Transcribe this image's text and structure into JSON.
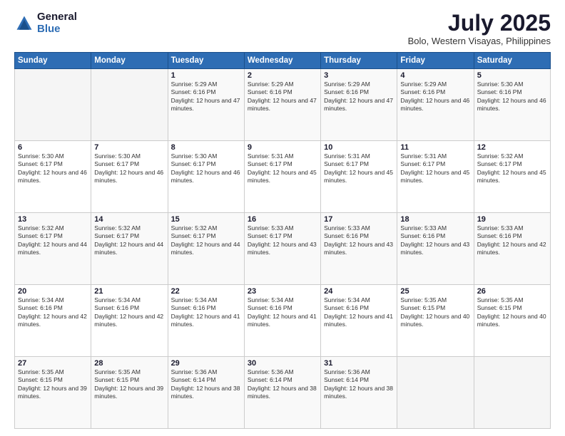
{
  "logo": {
    "general": "General",
    "blue": "Blue"
  },
  "header": {
    "month_year": "July 2025",
    "location": "Bolo, Western Visayas, Philippines"
  },
  "weekdays": [
    "Sunday",
    "Monday",
    "Tuesday",
    "Wednesday",
    "Thursday",
    "Friday",
    "Saturday"
  ],
  "weeks": [
    [
      {
        "day": "",
        "sunrise": "",
        "sunset": "",
        "daylight": ""
      },
      {
        "day": "",
        "sunrise": "",
        "sunset": "",
        "daylight": ""
      },
      {
        "day": "1",
        "sunrise": "Sunrise: 5:29 AM",
        "sunset": "Sunset: 6:16 PM",
        "daylight": "Daylight: 12 hours and 47 minutes."
      },
      {
        "day": "2",
        "sunrise": "Sunrise: 5:29 AM",
        "sunset": "Sunset: 6:16 PM",
        "daylight": "Daylight: 12 hours and 47 minutes."
      },
      {
        "day": "3",
        "sunrise": "Sunrise: 5:29 AM",
        "sunset": "Sunset: 6:16 PM",
        "daylight": "Daylight: 12 hours and 47 minutes."
      },
      {
        "day": "4",
        "sunrise": "Sunrise: 5:29 AM",
        "sunset": "Sunset: 6:16 PM",
        "daylight": "Daylight: 12 hours and 46 minutes."
      },
      {
        "day": "5",
        "sunrise": "Sunrise: 5:30 AM",
        "sunset": "Sunset: 6:16 PM",
        "daylight": "Daylight: 12 hours and 46 minutes."
      }
    ],
    [
      {
        "day": "6",
        "sunrise": "Sunrise: 5:30 AM",
        "sunset": "Sunset: 6:17 PM",
        "daylight": "Daylight: 12 hours and 46 minutes."
      },
      {
        "day": "7",
        "sunrise": "Sunrise: 5:30 AM",
        "sunset": "Sunset: 6:17 PM",
        "daylight": "Daylight: 12 hours and 46 minutes."
      },
      {
        "day": "8",
        "sunrise": "Sunrise: 5:30 AM",
        "sunset": "Sunset: 6:17 PM",
        "daylight": "Daylight: 12 hours and 46 minutes."
      },
      {
        "day": "9",
        "sunrise": "Sunrise: 5:31 AM",
        "sunset": "Sunset: 6:17 PM",
        "daylight": "Daylight: 12 hours and 45 minutes."
      },
      {
        "day": "10",
        "sunrise": "Sunrise: 5:31 AM",
        "sunset": "Sunset: 6:17 PM",
        "daylight": "Daylight: 12 hours and 45 minutes."
      },
      {
        "day": "11",
        "sunrise": "Sunrise: 5:31 AM",
        "sunset": "Sunset: 6:17 PM",
        "daylight": "Daylight: 12 hours and 45 minutes."
      },
      {
        "day": "12",
        "sunrise": "Sunrise: 5:32 AM",
        "sunset": "Sunset: 6:17 PM",
        "daylight": "Daylight: 12 hours and 45 minutes."
      }
    ],
    [
      {
        "day": "13",
        "sunrise": "Sunrise: 5:32 AM",
        "sunset": "Sunset: 6:17 PM",
        "daylight": "Daylight: 12 hours and 44 minutes."
      },
      {
        "day": "14",
        "sunrise": "Sunrise: 5:32 AM",
        "sunset": "Sunset: 6:17 PM",
        "daylight": "Daylight: 12 hours and 44 minutes."
      },
      {
        "day": "15",
        "sunrise": "Sunrise: 5:32 AM",
        "sunset": "Sunset: 6:17 PM",
        "daylight": "Daylight: 12 hours and 44 minutes."
      },
      {
        "day": "16",
        "sunrise": "Sunrise: 5:33 AM",
        "sunset": "Sunset: 6:17 PM",
        "daylight": "Daylight: 12 hours and 43 minutes."
      },
      {
        "day": "17",
        "sunrise": "Sunrise: 5:33 AM",
        "sunset": "Sunset: 6:16 PM",
        "daylight": "Daylight: 12 hours and 43 minutes."
      },
      {
        "day": "18",
        "sunrise": "Sunrise: 5:33 AM",
        "sunset": "Sunset: 6:16 PM",
        "daylight": "Daylight: 12 hours and 43 minutes."
      },
      {
        "day": "19",
        "sunrise": "Sunrise: 5:33 AM",
        "sunset": "Sunset: 6:16 PM",
        "daylight": "Daylight: 12 hours and 42 minutes."
      }
    ],
    [
      {
        "day": "20",
        "sunrise": "Sunrise: 5:34 AM",
        "sunset": "Sunset: 6:16 PM",
        "daylight": "Daylight: 12 hours and 42 minutes."
      },
      {
        "day": "21",
        "sunrise": "Sunrise: 5:34 AM",
        "sunset": "Sunset: 6:16 PM",
        "daylight": "Daylight: 12 hours and 42 minutes."
      },
      {
        "day": "22",
        "sunrise": "Sunrise: 5:34 AM",
        "sunset": "Sunset: 6:16 PM",
        "daylight": "Daylight: 12 hours and 41 minutes."
      },
      {
        "day": "23",
        "sunrise": "Sunrise: 5:34 AM",
        "sunset": "Sunset: 6:16 PM",
        "daylight": "Daylight: 12 hours and 41 minutes."
      },
      {
        "day": "24",
        "sunrise": "Sunrise: 5:34 AM",
        "sunset": "Sunset: 6:16 PM",
        "daylight": "Daylight: 12 hours and 41 minutes."
      },
      {
        "day": "25",
        "sunrise": "Sunrise: 5:35 AM",
        "sunset": "Sunset: 6:15 PM",
        "daylight": "Daylight: 12 hours and 40 minutes."
      },
      {
        "day": "26",
        "sunrise": "Sunrise: 5:35 AM",
        "sunset": "Sunset: 6:15 PM",
        "daylight": "Daylight: 12 hours and 40 minutes."
      }
    ],
    [
      {
        "day": "27",
        "sunrise": "Sunrise: 5:35 AM",
        "sunset": "Sunset: 6:15 PM",
        "daylight": "Daylight: 12 hours and 39 minutes."
      },
      {
        "day": "28",
        "sunrise": "Sunrise: 5:35 AM",
        "sunset": "Sunset: 6:15 PM",
        "daylight": "Daylight: 12 hours and 39 minutes."
      },
      {
        "day": "29",
        "sunrise": "Sunrise: 5:36 AM",
        "sunset": "Sunset: 6:14 PM",
        "daylight": "Daylight: 12 hours and 38 minutes."
      },
      {
        "day": "30",
        "sunrise": "Sunrise: 5:36 AM",
        "sunset": "Sunset: 6:14 PM",
        "daylight": "Daylight: 12 hours and 38 minutes."
      },
      {
        "day": "31",
        "sunrise": "Sunrise: 5:36 AM",
        "sunset": "Sunset: 6:14 PM",
        "daylight": "Daylight: 12 hours and 38 minutes."
      },
      {
        "day": "",
        "sunrise": "",
        "sunset": "",
        "daylight": ""
      },
      {
        "day": "",
        "sunrise": "",
        "sunset": "",
        "daylight": ""
      }
    ]
  ]
}
